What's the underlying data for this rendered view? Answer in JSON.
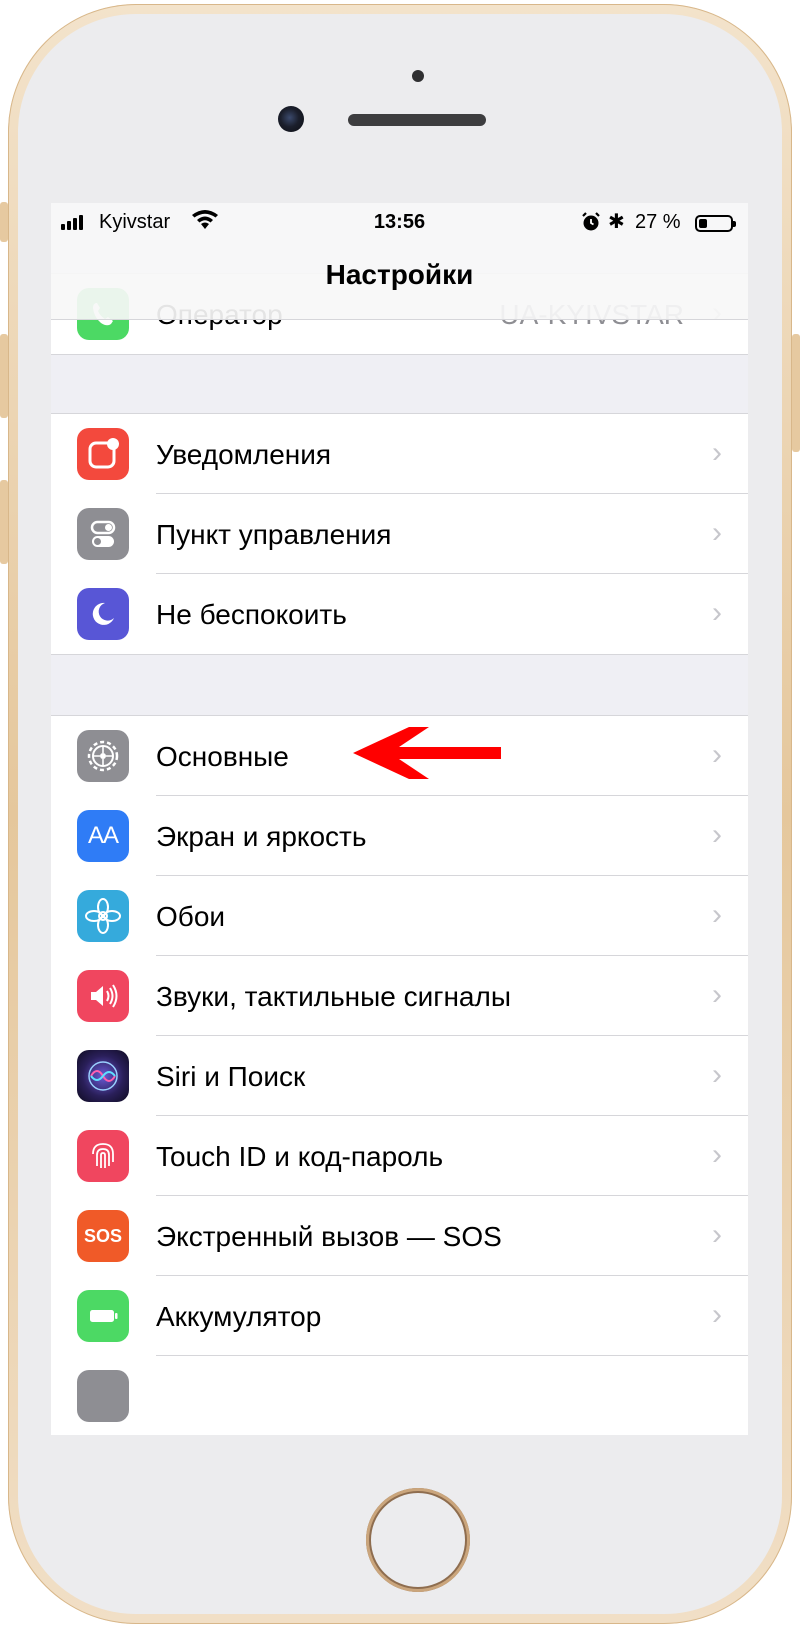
{
  "status_bar": {
    "carrier": "Kyivstar",
    "time": "13:56",
    "battery_percent": "27 %",
    "battery_level": 0.27
  },
  "nav": {
    "title": "Настройки"
  },
  "rows": {
    "operator": {
      "label": "Оператор",
      "value": "UA-KYIVSTAR"
    },
    "notifications": {
      "label": "Уведомления"
    },
    "control_center": {
      "label": "Пункт управления"
    },
    "dnd": {
      "label": "Не беспокоить"
    },
    "general": {
      "label": "Основные"
    },
    "display": {
      "label": "Экран и яркость",
      "icon_text": "AA"
    },
    "wallpaper": {
      "label": "Обои"
    },
    "sounds": {
      "label": "Звуки, тактильные сигналы"
    },
    "siri": {
      "label": "Siri и Поиск"
    },
    "touchid": {
      "label": "Touch ID и код-пароль"
    },
    "sos": {
      "label": "Экстренный вызов — SOS",
      "icon_text": "SOS"
    },
    "battery": {
      "label": "Аккумулятор"
    }
  },
  "colors": {
    "phone_icon": "#4cd964",
    "notifications_icon": "#f3493d",
    "gray_icon": "#8e8e93",
    "dnd_icon": "#5856d6",
    "display_icon": "#2f7cf6",
    "wallpaper_icon": "#35aadc",
    "sounds_icon": "#f0465f",
    "touchid_icon": "#f0465f",
    "sos_icon": "#f05a28",
    "battery_icon": "#4cd964",
    "arrow": "#ff0000"
  },
  "icons": {
    "operator": "phone-icon",
    "notifications": "notifications-icon",
    "control_center": "toggles-icon",
    "dnd": "moon-icon",
    "general": "gear-icon",
    "display": "text-size-icon",
    "wallpaper": "flower-icon",
    "sounds": "speaker-icon",
    "siri": "siri-icon",
    "touchid": "fingerprint-icon",
    "sos": "sos-icon",
    "battery": "battery-icon",
    "chevron": "chevron-right-icon",
    "annotation": "red-arrow-icon"
  }
}
